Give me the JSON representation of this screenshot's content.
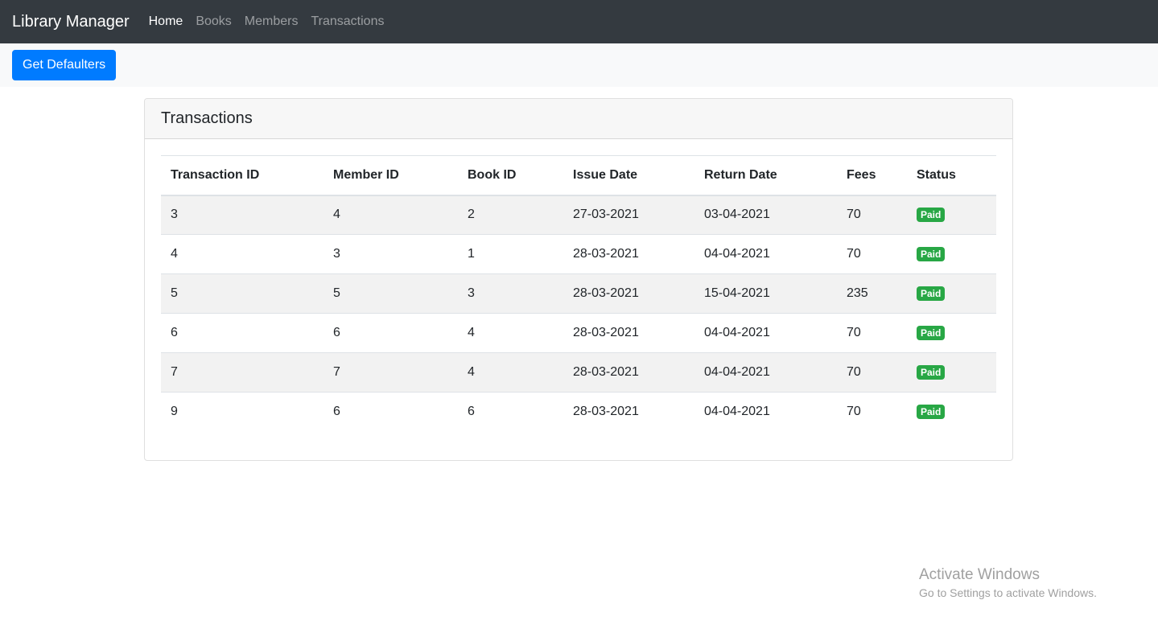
{
  "navbar": {
    "brand": "Library Manager",
    "links": [
      {
        "label": "Home",
        "active": true
      },
      {
        "label": "Books",
        "active": false
      },
      {
        "label": "Members",
        "active": false
      },
      {
        "label": "Transactions",
        "active": false
      }
    ]
  },
  "toolbar": {
    "defaulters_label": "Get Defaulters"
  },
  "card": {
    "title": "Transactions",
    "columns": [
      "Transaction ID",
      "Member ID",
      "Book ID",
      "Issue Date",
      "Return Date",
      "Fees",
      "Status"
    ],
    "rows": [
      {
        "transaction_id": "3",
        "member_id": "4",
        "book_id": "2",
        "issue_date": "27-03-2021",
        "return_date": "03-04-2021",
        "fees": "70",
        "status": "Paid"
      },
      {
        "transaction_id": "4",
        "member_id": "3",
        "book_id": "1",
        "issue_date": "28-03-2021",
        "return_date": "04-04-2021",
        "fees": "70",
        "status": "Paid"
      },
      {
        "transaction_id": "5",
        "member_id": "5",
        "book_id": "3",
        "issue_date": "28-03-2021",
        "return_date": "15-04-2021",
        "fees": "235",
        "status": "Paid"
      },
      {
        "transaction_id": "6",
        "member_id": "6",
        "book_id": "4",
        "issue_date": "28-03-2021",
        "return_date": "04-04-2021",
        "fees": "70",
        "status": "Paid"
      },
      {
        "transaction_id": "7",
        "member_id": "7",
        "book_id": "4",
        "issue_date": "28-03-2021",
        "return_date": "04-04-2021",
        "fees": "70",
        "status": "Paid"
      },
      {
        "transaction_id": "9",
        "member_id": "6",
        "book_id": "6",
        "issue_date": "28-03-2021",
        "return_date": "04-04-2021",
        "fees": "70",
        "status": "Paid"
      }
    ]
  },
  "watermark": {
    "title": "Activate Windows",
    "subtitle": "Go to Settings to activate Windows."
  },
  "colors": {
    "navbar_bg": "#343a40",
    "primary": "#007bff",
    "success": "#28a745"
  }
}
